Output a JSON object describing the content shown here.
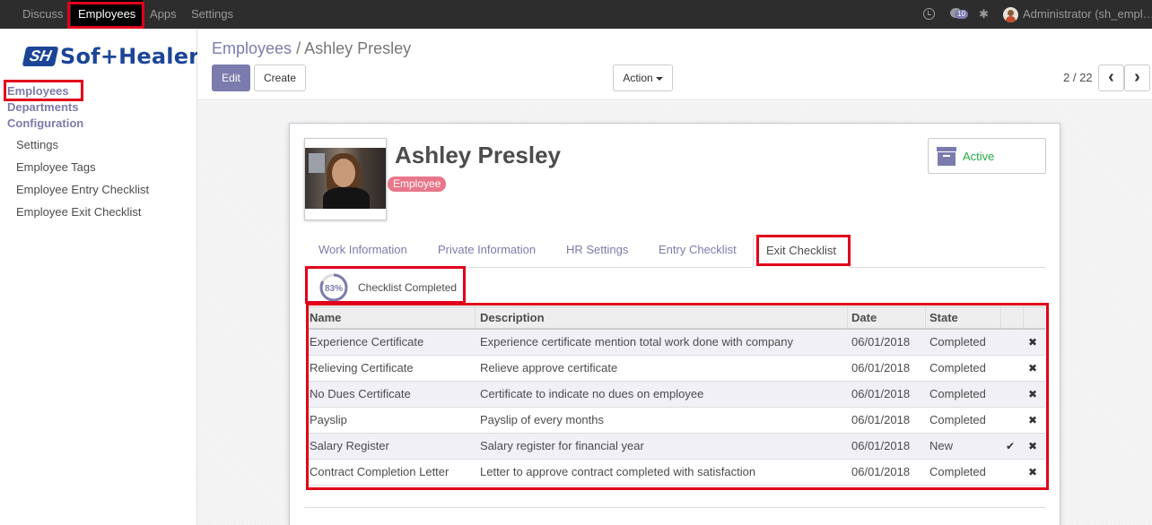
{
  "topbar": {
    "menu": [
      {
        "label": "Discuss"
      },
      {
        "label": "Employees"
      },
      {
        "label": "Apps"
      },
      {
        "label": "Settings"
      }
    ],
    "active_menu": "Employees",
    "messages_count": "10",
    "user_name": "Administrator (sh_empl…"
  },
  "sidebar": {
    "logo_mark": "SH",
    "logo_text": "Sof+Healer",
    "sections": [
      {
        "label": "Employees"
      },
      {
        "label": "Departments"
      },
      {
        "label": "Configuration"
      }
    ],
    "config_items": [
      {
        "label": "Settings"
      },
      {
        "label": "Employee Tags"
      },
      {
        "label": "Employee Entry Checklist"
      },
      {
        "label": "Employee Exit Checklist"
      }
    ]
  },
  "control": {
    "breadcrumb_parent": "Employees",
    "breadcrumb_sep": "/",
    "breadcrumb_current": "Ashley Presley",
    "edit_label": "Edit",
    "create_label": "Create",
    "action_label": "Action",
    "pager_value": "2 / 22",
    "prev_icon": "‹",
    "next_icon": "›"
  },
  "employee": {
    "name": "Ashley Presley",
    "tag": "Employee",
    "status": "Active"
  },
  "tabs": [
    {
      "label": "Work Information"
    },
    {
      "label": "Private Information"
    },
    {
      "label": "HR Settings"
    },
    {
      "label": "Entry Checklist"
    },
    {
      "label": "Exit Checklist"
    }
  ],
  "active_tab": "Exit Checklist",
  "progress": {
    "percent": 83,
    "percent_label": "83%",
    "label": "Checklist Completed"
  },
  "checklist": {
    "columns": [
      "Name",
      "Description",
      "Date",
      "State"
    ],
    "rows": [
      {
        "name": "Experience Certificate",
        "description": "Experience certificate mention total work done with company",
        "date": "06/01/2018",
        "state": "Completed",
        "can_complete": false
      },
      {
        "name": "Relieving Certificate",
        "description": "Relieve approve certificate",
        "date": "06/01/2018",
        "state": "Completed",
        "can_complete": false
      },
      {
        "name": "No Dues Certificate",
        "description": "Certificate to indicate no dues on employee",
        "date": "06/01/2018",
        "state": "Completed",
        "can_complete": false
      },
      {
        "name": "Payslip",
        "description": "Payslip of every months",
        "date": "06/01/2018",
        "state": "Completed",
        "can_complete": false
      },
      {
        "name": "Salary Register",
        "description": "Salary register for financial year",
        "date": "06/01/2018",
        "state": "New",
        "can_complete": true
      },
      {
        "name": "Contract Completion Letter",
        "description": "Letter to approve contract completed with satisfaction",
        "date": "06/01/2018",
        "state": "Completed",
        "can_complete": false
      }
    ],
    "check_icon": "✔",
    "remove_icon": "✖"
  },
  "colors": {
    "accent": "#7c7bad",
    "highlight": "#e0001a",
    "tag": "#e8768a",
    "active_status": "#28a745",
    "navbar": "#2d2d2d"
  }
}
